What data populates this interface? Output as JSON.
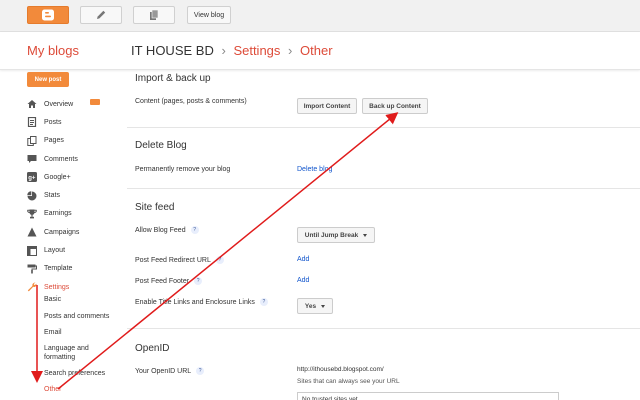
{
  "toolbar": {
    "view_blog": "View blog",
    "icons": [
      "blogger-icon",
      "pencil-icon",
      "pages-icon"
    ]
  },
  "header": {
    "my_blogs": "My blogs",
    "blog_name": "IT HOUSE BD",
    "crumb_settings": "Settings",
    "crumb_other": "Other",
    "separator": "›"
  },
  "sidebar": {
    "new_post": "New post",
    "items": [
      {
        "label": "Overview",
        "icon": "home-icon"
      },
      {
        "label": "Posts",
        "icon": "posts-icon"
      },
      {
        "label": "Pages",
        "icon": "pages-icon"
      },
      {
        "label": "Comments",
        "icon": "comments-icon"
      },
      {
        "label": "Google+",
        "icon": "google-plus-icon"
      },
      {
        "label": "Stats",
        "icon": "stats-icon"
      },
      {
        "label": "Earnings",
        "icon": "trophy-icon"
      },
      {
        "label": "Campaigns",
        "icon": "megaphone-icon"
      },
      {
        "label": "Layout",
        "icon": "layout-icon"
      },
      {
        "label": "Template",
        "icon": "paint-roller-icon"
      },
      {
        "label": "Settings",
        "icon": "wrench-icon"
      }
    ],
    "settings_sub": [
      "Basic",
      "Posts and comments",
      "Email",
      "Language and",
      "formatting",
      "Search preferences",
      "Other"
    ]
  },
  "main": {
    "import_backup": {
      "title": "Import & back up",
      "content_label": "Content (pages, posts & comments)",
      "import_button": "Import Content",
      "backup_button": "Back up Content"
    },
    "delete_blog": {
      "title": "Delete Blog",
      "label": "Permanently remove your blog",
      "link": "Delete blog"
    },
    "site_feed": {
      "title": "Site feed",
      "allow_label": "Allow Blog Feed",
      "allow_value": "Until Jump Break",
      "redirect_label": "Post Feed Redirect URL",
      "redirect_link": "Add",
      "footer_label": "Post Feed Footer",
      "footer_link": "Add",
      "enclosure_label": "Enable Title Links and Enclosure Links",
      "enclosure_value": "Yes",
      "help": "?"
    },
    "openid": {
      "title": "OpenID",
      "url_label": "Your OpenID URL",
      "url_value": "http://ithousebd.blogspot.com/",
      "trusted_label": "Sites that can always see your URL",
      "trusted_value": "No trusted sites yet"
    }
  },
  "colors": {
    "accent": "#dd4b39",
    "orange": "#f28a3b",
    "link": "#1155cc",
    "annotation": "#e01b1b"
  }
}
